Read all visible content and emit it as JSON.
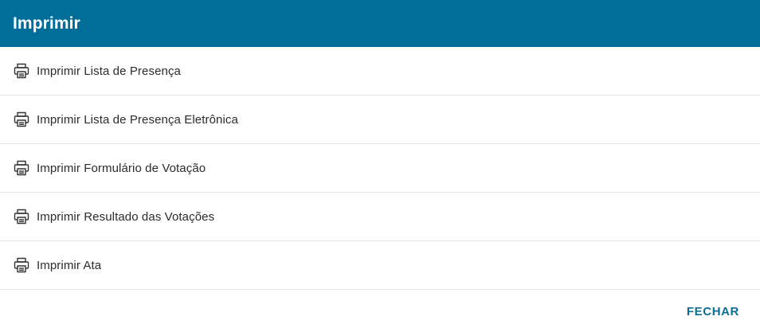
{
  "dialog": {
    "title": "Imprimir",
    "header_color": "#006e99",
    "accent_color": "#0b6e99",
    "items": [
      {
        "label": "Imprimir Lista de Presença",
        "icon": "printer-icon"
      },
      {
        "label": "Imprimir Lista de Presença Eletrônica",
        "icon": "printer-icon"
      },
      {
        "label": "Imprimir Formulário de Votação",
        "icon": "printer-icon"
      },
      {
        "label": "Imprimir Resultado das Votações",
        "icon": "printer-icon"
      },
      {
        "label": "Imprimir Ata",
        "icon": "printer-icon"
      }
    ],
    "close_label": "FECHAR"
  }
}
